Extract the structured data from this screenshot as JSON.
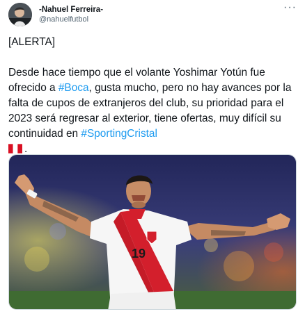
{
  "author": {
    "display_name": "-Nahuel Ferreira-",
    "handle": "@nahuelfutbol",
    "avatar_icon": "person-avatar"
  },
  "menu": {
    "more_icon": "more-horizontal-icon",
    "label": "···"
  },
  "tweet": {
    "alert": "[ALERTA]",
    "part1": "Desde hace tiempo que el volante Yoshimar Yotún fue ofrecido a ",
    "hashtag1": "#Boca",
    "part2": ", gusta mucho, pero no hay avances por la falta de cupos de extranjeros del club, su prioridad para el 2023 será regresar al exterior, tiene ofertas, muy difícil su continuidad en ",
    "hashtag2": "#SportingCristal",
    "flag_icon": "peru-flag-icon",
    "end": "."
  },
  "media": {
    "jersey_number": "19",
    "colors": {
      "hashtag": "#1d9bf0",
      "flag_red": "#d91023",
      "jersey_red": "#d31f2c"
    }
  }
}
